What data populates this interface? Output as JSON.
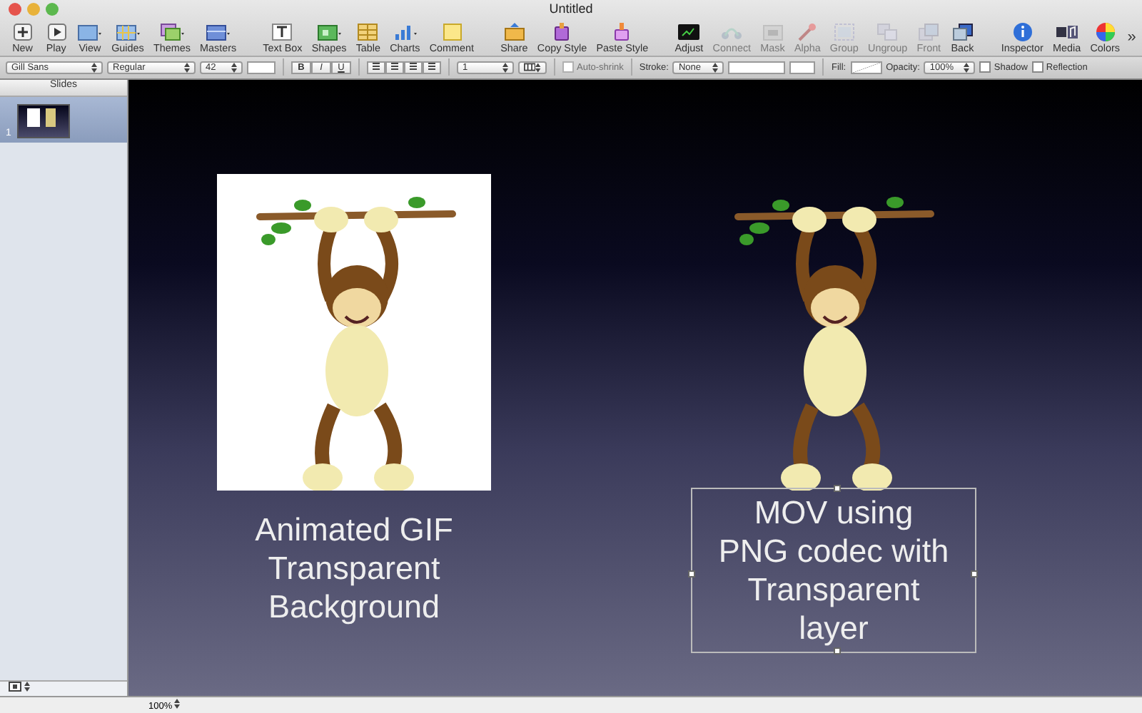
{
  "window": {
    "title": "Untitled"
  },
  "toolbar": [
    {
      "label": "New",
      "disabled": false
    },
    {
      "label": "Play",
      "disabled": false
    },
    {
      "label": "View",
      "disabled": false
    },
    {
      "label": "Guides",
      "disabled": false
    },
    {
      "label": "Themes",
      "disabled": false
    },
    {
      "label": "Masters",
      "disabled": false
    },
    {
      "label": "Text Box",
      "disabled": false
    },
    {
      "label": "Shapes",
      "disabled": false
    },
    {
      "label": "Table",
      "disabled": false
    },
    {
      "label": "Charts",
      "disabled": false
    },
    {
      "label": "Comment",
      "disabled": false
    },
    {
      "label": "Share",
      "disabled": false
    },
    {
      "label": "Copy Style",
      "disabled": false
    },
    {
      "label": "Paste Style",
      "disabled": false
    },
    {
      "label": "Adjust",
      "disabled": false
    },
    {
      "label": "Connect",
      "disabled": true
    },
    {
      "label": "Mask",
      "disabled": true
    },
    {
      "label": "Alpha",
      "disabled": true
    },
    {
      "label": "Group",
      "disabled": true
    },
    {
      "label": "Ungroup",
      "disabled": true
    },
    {
      "label": "Front",
      "disabled": true
    },
    {
      "label": "Back",
      "disabled": false
    },
    {
      "label": "Inspector",
      "disabled": false
    },
    {
      "label": "Media",
      "disabled": false
    },
    {
      "label": "Colors",
      "disabled": false
    }
  ],
  "toolbar_overflow": "»",
  "format_bar": {
    "font": "Gill Sans",
    "style": "Regular",
    "size": "42",
    "bold": "B",
    "italic": "I",
    "underline": "U",
    "line_spacing": "1",
    "auto_shrink": {
      "label": "Auto-shrink",
      "checked": false,
      "disabled": true
    },
    "stroke_label": "Stroke:",
    "stroke": "None",
    "fill_label": "Fill:",
    "opacity_label": "Opacity:",
    "opacity": "100%",
    "shadow": {
      "label": "Shadow",
      "checked": false
    },
    "reflection": {
      "label": "Reflection",
      "checked": false
    }
  },
  "sidebar": {
    "title": "Slides",
    "slides": [
      {
        "number": "1",
        "selected": true
      }
    ]
  },
  "slide": {
    "captions": [
      {
        "text": "Animated GIF\nTransparent\nBackground",
        "selected": false
      },
      {
        "text": "MOV using\nPNG codec with\nTransparent\nlayer",
        "selected": true
      }
    ]
  },
  "status_bar": {
    "zoom": "100%"
  }
}
